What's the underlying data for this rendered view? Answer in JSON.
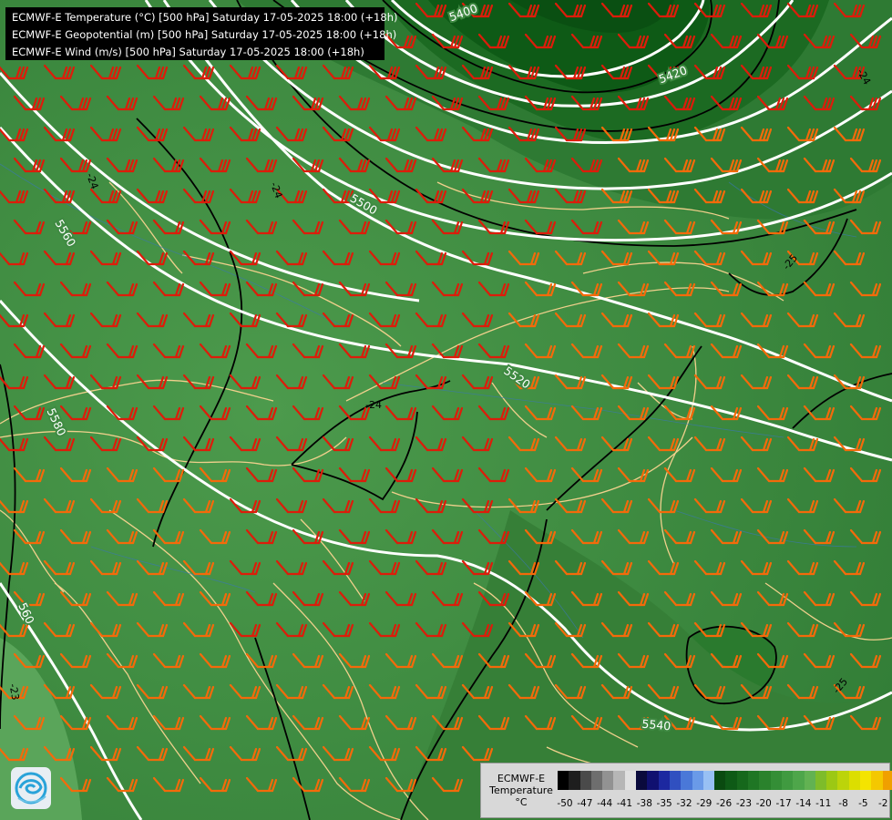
{
  "header": {
    "lines": [
      "ECMWF-E Temperature (°C) [500 hPa] Saturday 17-05-2025 18:00 (+18h)",
      "ECMWF-E Geopotential (m) [500 hPa] Saturday 17-05-2025 18:00 (+18h)",
      "ECMWF-E Wind (m/s) [500 hPa] Saturday 17-05-2025 18:00 (+18h)"
    ]
  },
  "legend": {
    "label_lines": [
      "ECMWF-E",
      "Temperature",
      "°C"
    ],
    "ticks": [
      "-50",
      "-47",
      "-44",
      "-41",
      "-38",
      "-35",
      "-32",
      "-29",
      "-26",
      "-23",
      "-20",
      "-17",
      "-14",
      "-11",
      "-8",
      "-5",
      "-2"
    ],
    "colors": [
      "#000000",
      "#1e1e1e",
      "#4a4a4a",
      "#6e6e6e",
      "#929292",
      "#b6b6b6",
      "#e0e0e0",
      "#0a0a3c",
      "#101070",
      "#1c28a0",
      "#3050c0",
      "#4a78d8",
      "#6a9ae8",
      "#98c0f4",
      "#0a4a10",
      "#0e5a16",
      "#16681c",
      "#1f7624",
      "#2a822c",
      "#348e36",
      "#409a40",
      "#4ea64a",
      "#62b252",
      "#7ebc2a",
      "#9cc814",
      "#bcd40a",
      "#dcde00",
      "#f4e400",
      "#f4c800",
      "#f0a000",
      "#ec7800",
      "#e44c00",
      "#d42000",
      "#b80000",
      "#c00060",
      "#a000a0",
      "#7a00c0",
      "#5000a0"
    ]
  },
  "contour_labels": {
    "geopotential": [
      "5400",
      "5420",
      "5500",
      "5520",
      "5540",
      "5560",
      "5580",
      "560"
    ],
    "temperature": [
      "-24",
      "-24",
      "-24",
      "-24",
      "-25",
      "-25",
      "-23"
    ]
  },
  "colors": {
    "background": "#3f8a42",
    "dark_green": "#0e5a16",
    "geopotential_lines": "#ffffff",
    "isotherms": "#000000",
    "coastlines": "#f0d08c",
    "wind_red": "#dd1c0a",
    "wind_orange": "#f46a0a"
  },
  "logo": {
    "icon": "ecmwf-logo-icon"
  }
}
